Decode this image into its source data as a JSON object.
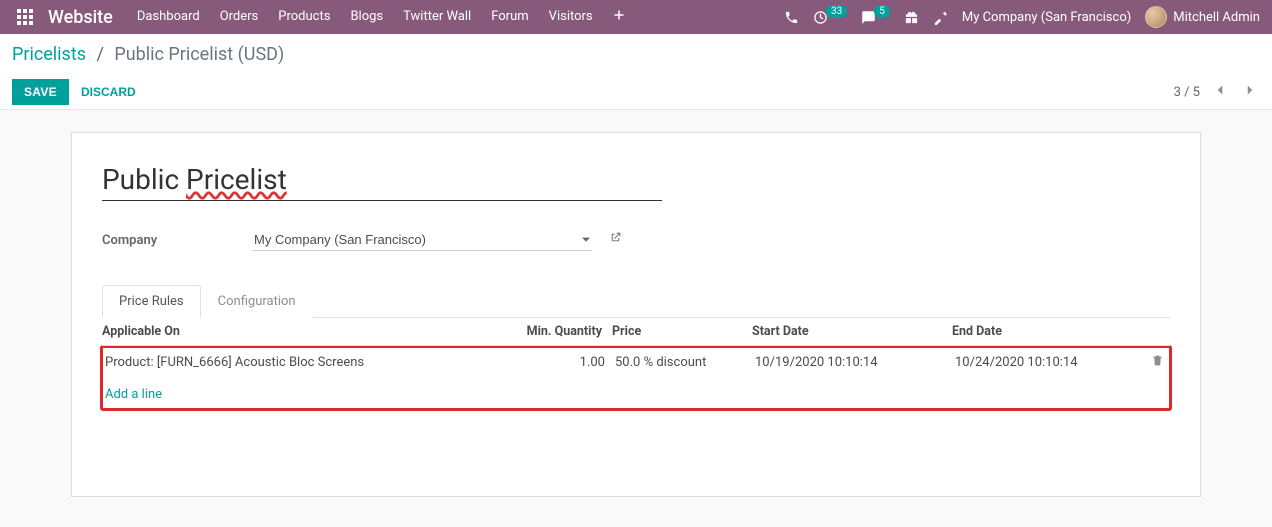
{
  "navbar": {
    "brand": "Website",
    "menu": [
      "Dashboard",
      "Orders",
      "Products",
      "Blogs",
      "Twitter Wall",
      "Forum",
      "Visitors"
    ],
    "badge_activities": "33",
    "badge_discuss": "5",
    "company": "My Company (San Francisco)",
    "user": "Mitchell Admin"
  },
  "breadcrumb": {
    "root": "Pricelists",
    "current": "Public Pricelist (USD)"
  },
  "buttons": {
    "save": "Save",
    "discard": "Discard"
  },
  "pager": {
    "text": "3 / 5"
  },
  "record": {
    "name_pre": "Public ",
    "name_mis": "Pricelist",
    "company_label": "Company",
    "company_value": "My Company (San Francisco)"
  },
  "tabs": {
    "rules": "Price Rules",
    "config": "Configuration"
  },
  "table": {
    "headers": {
      "applicable": "Applicable On",
      "minqty": "Min. Quantity",
      "price": "Price",
      "start": "Start Date",
      "end": "End Date"
    },
    "row": {
      "applicable": "Product: [FURN_6666] Acoustic Bloc Screens",
      "minqty": "1.00",
      "price": "50.0 % discount",
      "start": "10/19/2020 10:10:14",
      "end": "10/24/2020 10:10:14"
    },
    "add_line": "Add a line"
  }
}
